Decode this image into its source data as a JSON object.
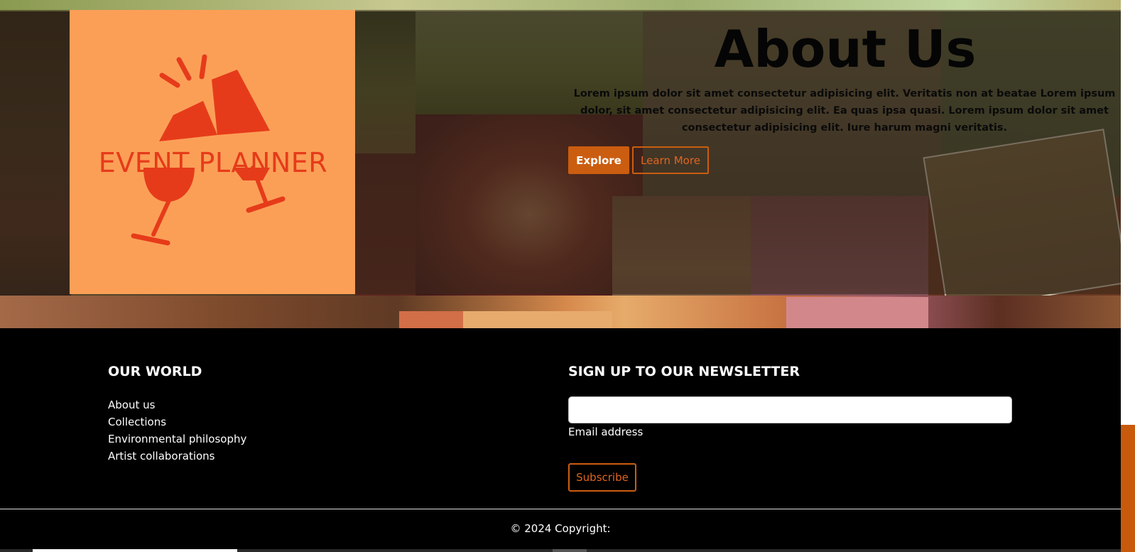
{
  "logo": {
    "text": "EVENT PLANNER",
    "background_color": "#fb9f57",
    "icon_color": "#e63b1a",
    "icon": "clinking-glasses-icon"
  },
  "about": {
    "title": "About Us",
    "text": "Lorem ipsum dolor sit amet consectetur adipisicing elit. Veritatis non at beatae Lorem ipsum dolor, sit amet consectetur adipisicing elit. Ea quas ipsa quasi. Lorem ipsum dolor sit amet consectetur adipisicing elit. Iure harum magni veritatis.",
    "explore_label": "Explore",
    "learn_more_label": "Learn More"
  },
  "footer": {
    "world": {
      "title": "OUR WORLD",
      "links": [
        "About us",
        "Collections",
        "Environmental philosophy",
        "Artist collaborations"
      ]
    },
    "newsletter": {
      "title": "SIGN UP TO OUR NEWSLETTER",
      "email_value": "",
      "email_label": "Email address",
      "subscribe_label": "Subscribe"
    },
    "copyright": "© 2024 Copyright:"
  },
  "colors": {
    "accent": "#cb5d10",
    "accent_text": "#e0651e",
    "footer_background": "#000000"
  }
}
